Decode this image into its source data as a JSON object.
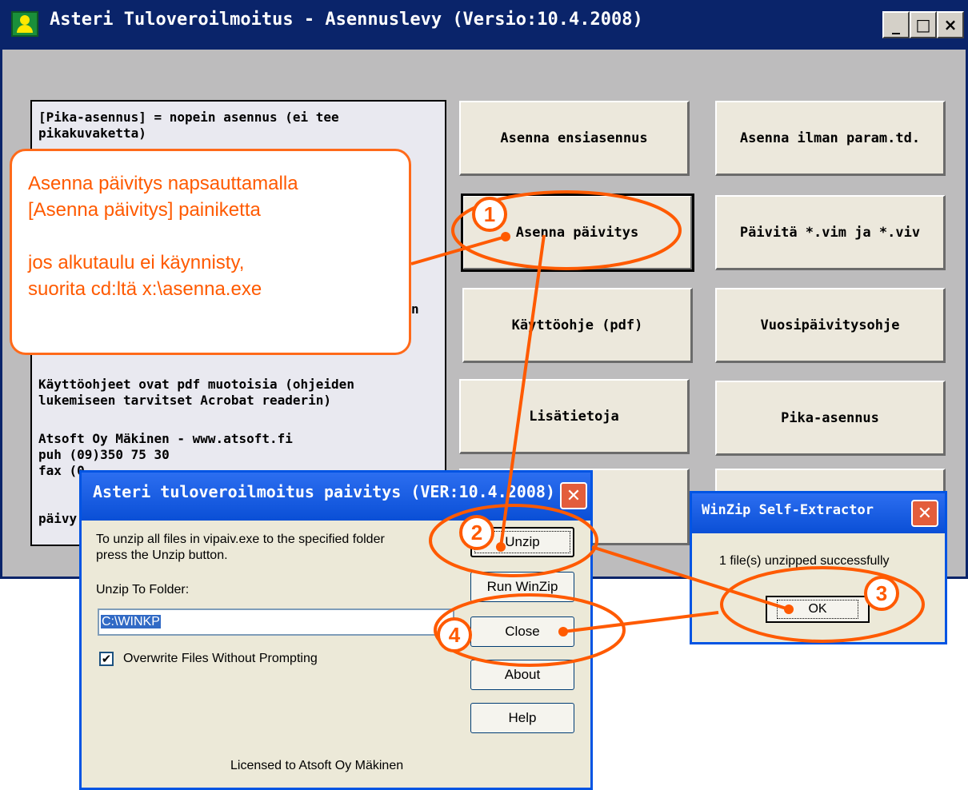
{
  "main_window": {
    "title": "Asteri Tuloveroilmoitus - Asennuslevy (Versio:10.4.2008)",
    "caption_buttons": {
      "minimize": "_",
      "maximize": "□",
      "close": "×"
    }
  },
  "info_panel": {
    "lines": [
      "[Pika-asennus] = nopein asennus (ei tee pikakuvaketta)",
      "n",
      "Käyttöohjeet ovat pdf muotoisia (ohjeiden lukemiseen tarvitset Acrobat readerin)",
      "Atsoft Oy Mäkinen - www.atsoft.fi",
      "puh (09)350 75 30",
      "fax (0",
      "päivy"
    ]
  },
  "buttons": {
    "ensiasennus": "Asenna ensiasennus",
    "ilman_param": "Asenna ilman param.td.",
    "paivitys": "Asenna päivitys",
    "paivita_vim": "Päivitä *.vim ja *.viv",
    "kayttoohje": "Käyttöohje (pdf)",
    "vuosipaivitysohje": "Vuosipäivitysohje",
    "lisatietoja": "Lisätietoja",
    "pika_asennus": "Pika-asennus"
  },
  "callout": {
    "line1": "Asenna päivitys napsauttamalla",
    "line2": "[Asenna päivitys] painiketta",
    "line3": "jos alkutaulu ei käynnisty,",
    "line4": "suorita cd:ltä x:\\asenna.exe"
  },
  "unzip_dialog": {
    "title": "Asteri tuloveroilmoitus paivitys (VER:10.4.2008)",
    "description_line1": "To unzip all files in vipaiv.exe to the specified folder",
    "description_line2": "press the Unzip button.",
    "folder_label": "Unzip To Folder:",
    "folder_value": "C:\\WINKP",
    "overwrite_label": "Overwrite Files Without Prompting",
    "overwrite_checked": true,
    "buttons": {
      "unzip": "Unzip",
      "run_winzip": "Run WinZip",
      "close": "Close",
      "about": "About",
      "help": "Help"
    },
    "license": "Licensed to Atsoft Oy Mäkinen"
  },
  "winzip_dialog": {
    "title": "WinZip Self-Extractor",
    "message": "1 file(s) unzipped successfully",
    "ok": "OK"
  },
  "annotations": {
    "color": "#ff5a00",
    "steps": [
      "1",
      "2",
      "3",
      "4"
    ]
  },
  "colors": {
    "titlebar": "#0a246a",
    "xp_titlebar": "#0054e3",
    "window_bg": "#bdbcbd",
    "button_face": "#ece8dc"
  }
}
